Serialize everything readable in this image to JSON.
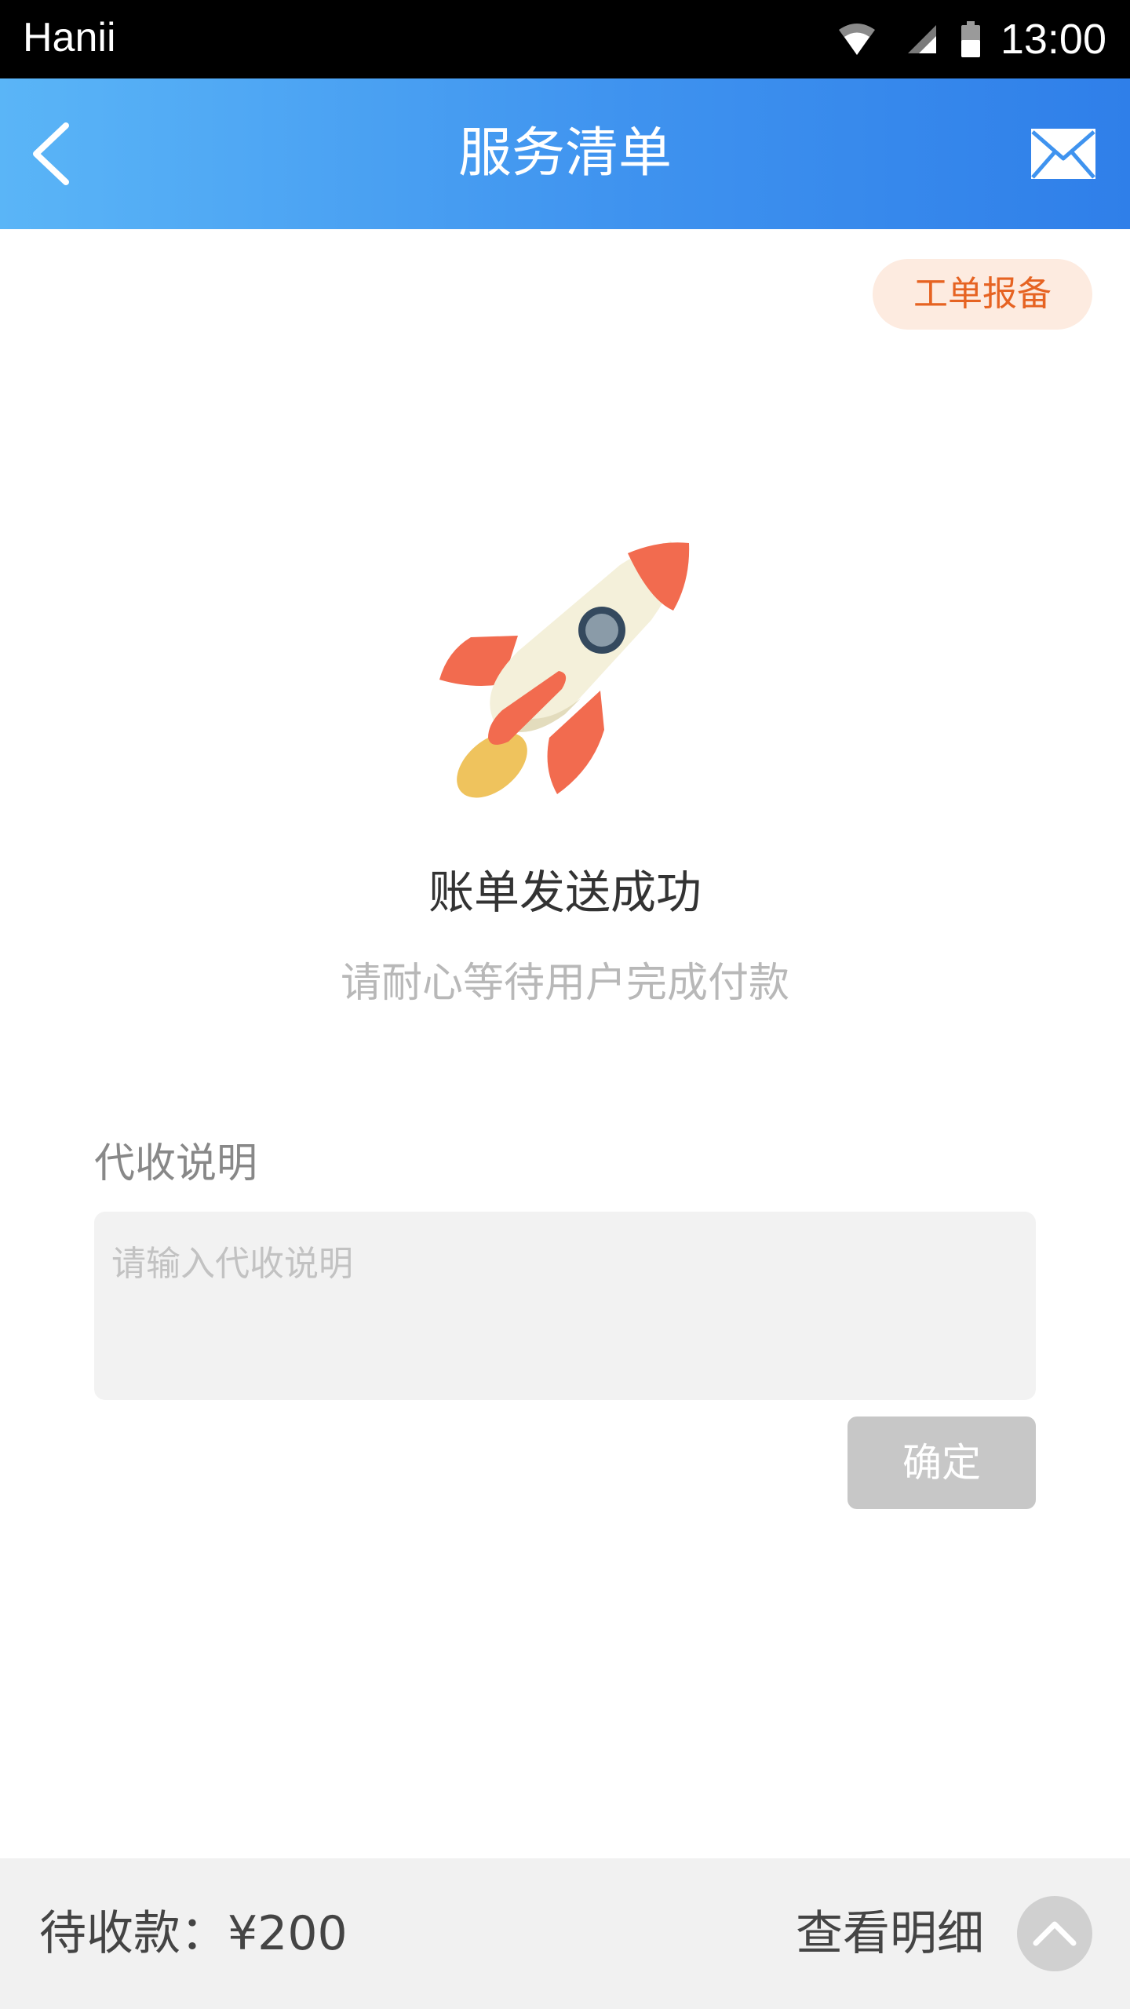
{
  "status_bar": {
    "carrier": "Hanii",
    "time": "13:00",
    "icons": [
      "wifi-icon",
      "cellular-signal-icon",
      "battery-icon"
    ]
  },
  "app_bar": {
    "title": "服务清单",
    "back_icon": "chevron-left-icon",
    "mail_icon": "mail-icon"
  },
  "work_order_button": {
    "label": "工单报备",
    "text_color": "#e66322",
    "bg_color": "#fdebe0"
  },
  "illustration": "rocket-icon",
  "success": {
    "title": "账单发送成功",
    "subtitle": "请耐心等待用户完成付款"
  },
  "collect_note": {
    "label": "代收说明",
    "placeholder": "请输入代收说明",
    "value": ""
  },
  "confirm_button": {
    "label": "确定"
  },
  "bottom_bar": {
    "pending_text": "待收款：¥200",
    "view_detail": "查看明细",
    "expand_icon": "chevron-up-icon"
  },
  "colors": {
    "accent_start": "#5ab5f7",
    "accent_end": "#2f7fe9",
    "rocket_body": "#f4f0da",
    "rocket_fins": "#f26b4f",
    "rocket_flame": "#efc35d"
  }
}
